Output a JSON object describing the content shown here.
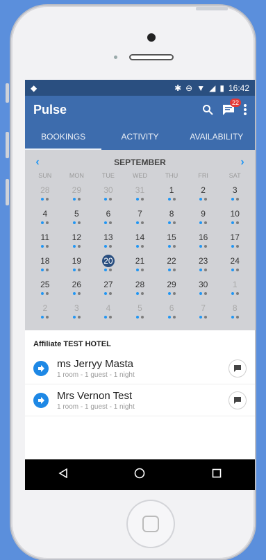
{
  "status": {
    "time": "16:42"
  },
  "appbar": {
    "title": "Pulse",
    "badge_count": "22"
  },
  "tabs": [
    "BOOKINGS",
    "ACTIVITY",
    "AVAILABILITY"
  ],
  "calendar": {
    "month": "SEPTEMBER",
    "weekdays": [
      "SUN",
      "MON",
      "TUE",
      "WED",
      "THU",
      "FRI",
      "SAT"
    ],
    "selected_day": "20",
    "weeks": [
      [
        "28",
        "29",
        "30",
        "31",
        "1",
        "2",
        "3"
      ],
      [
        "4",
        "5",
        "6",
        "7",
        "8",
        "9",
        "10"
      ],
      [
        "11",
        "12",
        "13",
        "14",
        "15",
        "16",
        "17"
      ],
      [
        "18",
        "19",
        "20",
        "21",
        "22",
        "23",
        "24"
      ],
      [
        "25",
        "26",
        "27",
        "28",
        "29",
        "30",
        "1"
      ],
      [
        "2",
        "3",
        "4",
        "5",
        "6",
        "7",
        "8"
      ]
    ]
  },
  "hotel_name": "Affiliate TEST HOTEL",
  "bookings": [
    {
      "name": "ms Jerryy Masta",
      "detail": "1 room - 1 guest - 1 night"
    },
    {
      "name": "Mrs Vernon Test",
      "detail": "1 room - 1 guest - 1 night"
    }
  ],
  "colors": {
    "primary": "#3d6cad",
    "accent": "#2196f3",
    "statusbar": "#2a4f80"
  }
}
